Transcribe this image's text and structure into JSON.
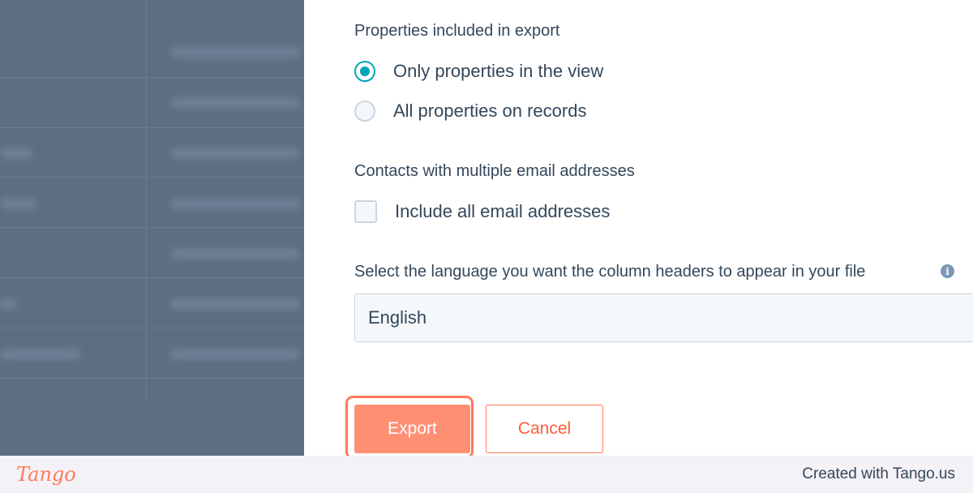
{
  "properties": {
    "label": "Properties included in export",
    "options": [
      {
        "label": "Only properties in the view",
        "selected": true
      },
      {
        "label": "All properties on records",
        "selected": false
      }
    ]
  },
  "emails": {
    "label": "Contacts with multiple email addresses",
    "checkbox_label": "Include all email addresses",
    "checked": false
  },
  "language": {
    "label": "Select the language you want the column headers to appear in your file",
    "info_icon": "info-icon",
    "selected": "English"
  },
  "actions": {
    "export_label": "Export",
    "cancel_label": "Cancel"
  },
  "footer": {
    "logo": "Tango",
    "credit": "Created with Tango.us"
  },
  "colors": {
    "accent_teal": "#00a4bd",
    "primary_orange": "#ff7a59",
    "text": "#33475b",
    "overlay": "#5c6e80"
  }
}
